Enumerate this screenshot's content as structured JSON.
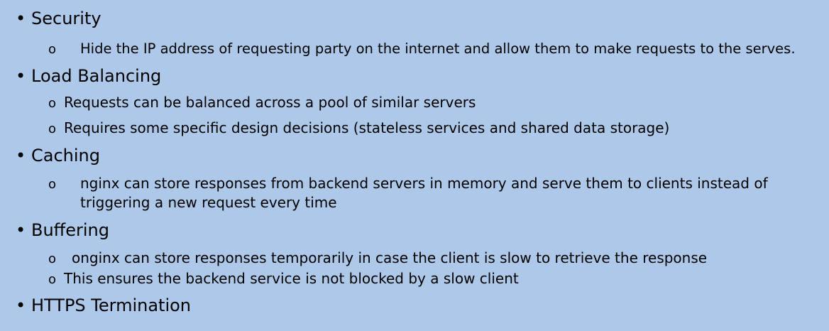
{
  "bullet_glyphs": {
    "level1": "•",
    "level2": "o"
  },
  "sections": [
    {
      "heading": "Security",
      "items": [
        "Hide the IP address of requesting party on the internet and allow them to make requests to the serves."
      ]
    },
    {
      "heading": "Load Balancing",
      "items": [
        "Requests can be balanced across a pool of similar servers",
        "Requires some specific design decisions (stateless services and shared data storage)"
      ]
    },
    {
      "heading": "Caching",
      "items": [
        "nginx can store responses from backend servers in memory and serve them to clients instead of",
        "triggering a new request every time"
      ]
    },
    {
      "heading": "Buffering",
      "items": [
        "onginx can store responses temporarily in case the client is slow to retrieve the response",
        "This ensures the backend service is not blocked by a slow client"
      ]
    },
    {
      "heading": "HTTPS Termination",
      "items": []
    }
  ]
}
